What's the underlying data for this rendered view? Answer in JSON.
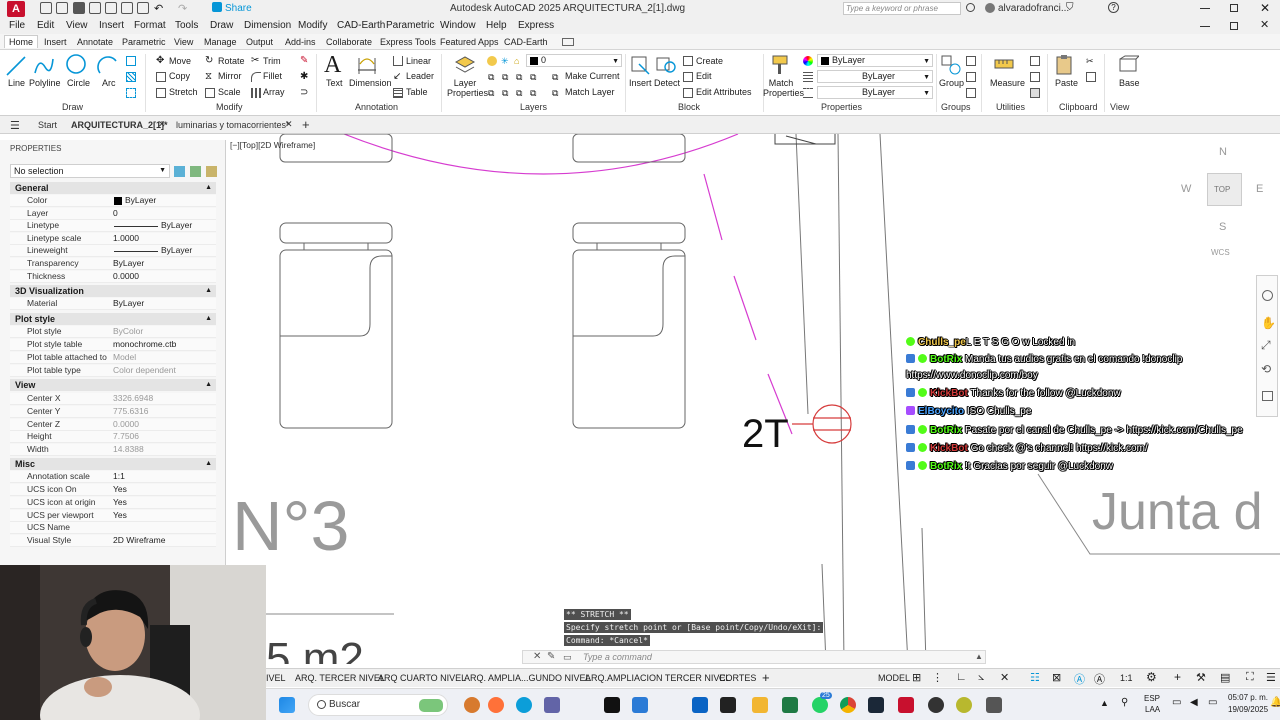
{
  "titlebar": {
    "app_title": "Autodesk AutoCAD 2025   ARQUITECTURA_2[1].dwg",
    "share_label": "Share",
    "search_placeholder": "Type a keyword or phrase",
    "user_name": "alvaradofranci..."
  },
  "menu": [
    "File",
    "Edit",
    "View",
    "Insert",
    "Format",
    "Tools",
    "Draw",
    "Dimension",
    "Modify",
    "CAD-Earth",
    "Parametric",
    "Window",
    "Help",
    "Express"
  ],
  "ribbon_tabs": [
    "Home",
    "Insert",
    "Annotate",
    "Parametric",
    "View",
    "Manage",
    "Output",
    "Add-ins",
    "Collaborate",
    "Express Tools",
    "Featured Apps",
    "CAD-Earth"
  ],
  "ribbon": {
    "draw": {
      "line": "Line",
      "polyline": "Polyline",
      "circle": "Circle",
      "arc": "Arc",
      "group": "Draw"
    },
    "modify": {
      "move": "Move",
      "rotate": "Rotate",
      "trim": "Trim",
      "copy": "Copy",
      "mirror": "Mirror",
      "fillet": "Fillet",
      "stretch": "Stretch",
      "scale": "Scale",
      "array": "Array",
      "group": "Modify"
    },
    "annotation": {
      "text": "Text",
      "dimension": "Dimension",
      "linear": "Linear",
      "leader": "Leader",
      "table": "Table",
      "group": "Annotation"
    },
    "layers": {
      "layer_properties": "Layer Properties",
      "layer_value": "0",
      "make_current": "Make Current",
      "match_layer": "Match Layer",
      "group": "Layers"
    },
    "block": {
      "insert": "Insert",
      "detect": "Detect",
      "create": "Create",
      "edit": "Edit",
      "edit_attributes": "Edit Attributes",
      "group": "Block"
    },
    "properties": {
      "match_properties": "Match Properties",
      "color": "ByLayer",
      "lineweight": "ByLayer",
      "linetype": "ByLayer",
      "group": "Properties"
    },
    "groups": {
      "group_btn": "Group",
      "group": "Groups"
    },
    "utilities": {
      "measure": "Measure",
      "group": "Utilities"
    },
    "clipboard": {
      "paste": "Paste",
      "group": "Clipboard"
    },
    "view": {
      "base": "Base",
      "group": "View"
    }
  },
  "doc_tabs": {
    "start": "Start",
    "active": "ARQUITECTURA_2[1]*",
    "other": "luminarias y tomacorrientes*"
  },
  "viewport_label": "[−][Top][2D Wireframe]",
  "properties": {
    "header": "PROPERTIES",
    "selection": "No selection",
    "sections": [
      {
        "title": "General",
        "rows": [
          {
            "key": "Color",
            "value": "ByLayer"
          },
          {
            "key": "Layer",
            "value": "0"
          },
          {
            "key": "Linetype",
            "value": "ByLayer"
          },
          {
            "key": "Linetype scale",
            "value": "1.0000"
          },
          {
            "key": "Lineweight",
            "value": "ByLayer"
          },
          {
            "key": "Transparency",
            "value": "ByLayer"
          },
          {
            "key": "Thickness",
            "value": "0.0000"
          }
        ]
      },
      {
        "title": "3D Visualization",
        "rows": [
          {
            "key": "Material",
            "value": "ByLayer"
          }
        ]
      },
      {
        "title": "Plot style",
        "rows": [
          {
            "key": "Plot style",
            "value": "ByColor"
          },
          {
            "key": "Plot style table",
            "value": "monochrome.ctb"
          },
          {
            "key": "Plot table attached to",
            "value": "Model"
          },
          {
            "key": "Plot table type",
            "value": "Color dependent"
          }
        ]
      },
      {
        "title": "View",
        "rows": [
          {
            "key": "Center X",
            "value": "3326.6948"
          },
          {
            "key": "Center Y",
            "value": "775.6316"
          },
          {
            "key": "Center Z",
            "value": "0.0000"
          },
          {
            "key": "Height",
            "value": "7.7506"
          },
          {
            "key": "Width",
            "value": "14.8388"
          }
        ]
      },
      {
        "title": "Misc",
        "rows": [
          {
            "key": "Annotation scale",
            "value": "1:1"
          },
          {
            "key": "UCS icon On",
            "value": "Yes"
          },
          {
            "key": "UCS icon at origin",
            "value": "Yes"
          },
          {
            "key": "UCS per viewport",
            "value": "Yes"
          },
          {
            "key": "UCS Name",
            "value": ""
          },
          {
            "key": "Visual Style",
            "value": "2D Wireframe"
          }
        ]
      }
    ]
  },
  "drawing_text": {
    "room_no": "N°3",
    "area": "5 m2",
    "outlet": "2T",
    "junta": "Junta d"
  },
  "viewcube": {
    "n": "N",
    "s": "S",
    "e": "E",
    "w": "W",
    "top": "TOP",
    "wcs": "WCS"
  },
  "chat": [
    {
      "user": "Chulls_pe",
      "user_color": "#f2c94c",
      "text": "L E T S   G O  w Locked in"
    },
    {
      "user": "BotRix",
      "user_color": "#53fc18",
      "text": " Manda tus audios gratis en el comando !donoclip"
    },
    {
      "user": "",
      "user_color": "#ffffff",
      "text": "https://www.donoclip.com/boy"
    },
    {
      "user": "KickBot",
      "user_color": "#d13b3b",
      "text": " Thanks for the follow @Luckdonw"
    },
    {
      "user": "ElBoycito",
      "user_color": "#4aa3ff",
      "text": " ISO Chulls_pe"
    },
    {
      "user": "BotRix",
      "user_color": "#53fc18",
      "text": " Pasate por el canal de Chulls_pe -> https://kick.com/Chulls_pe"
    },
    {
      "user": "KickBot",
      "user_color": "#d13b3b",
      "text": " Go check @'s channel! https://kick.com/"
    },
    {
      "user": "BotRix",
      "user_color": "#53fc18",
      "text": " !t Gracias por seguir @Luckdonw"
    }
  ],
  "command": {
    "line1": "** STRETCH **",
    "line2": "Specify stretch point or [Base point/Copy/Undo/eXit]:",
    "line3": "Command: *Cancel*",
    "placeholder": "Type a command"
  },
  "layout_tabs": [
    "IVEL",
    "ARQ. TERCER NIVEL",
    "ARQ CUARTO NIVEL",
    "ARQ. AMPLIA...GUNDO NIVEL",
    "ARQ.AMPLIACION TERCER NIVEL",
    "CORTES"
  ],
  "status": {
    "model": "MODEL",
    "scale": "1:1"
  },
  "taskbar": {
    "search": "Buscar",
    "lang": "ESP",
    "lang2": "LAA",
    "time": "05:07 p. m.",
    "date": "19/09/2025",
    "badge": "25"
  },
  "colors": {
    "accent": "#0696d7",
    "autocad_red": "#c8102e",
    "magenta": "#d63cd0",
    "cmd_bg": "#4f4f4f"
  }
}
